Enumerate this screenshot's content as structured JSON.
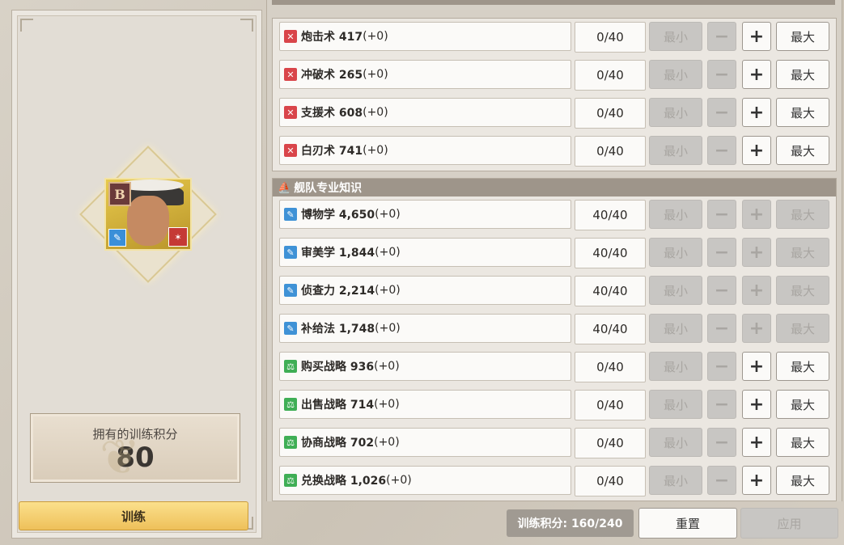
{
  "left": {
    "rank_letter": "B",
    "points_label": "拥有的训练积分",
    "points_value": "80",
    "train_label": "训练"
  },
  "skill_groups": [
    {
      "header": "",
      "rows": [
        {
          "icon": "crossed-swords-icon",
          "name": "炮击术 417",
          "bonus": "(+0)",
          "progress": "0/40",
          "min_label": "最小",
          "max_label": "最大",
          "plus_enabled": true,
          "max_enabled": true
        },
        {
          "icon": "crossed-swords-icon",
          "name": "冲破术 265",
          "bonus": "(+0)",
          "progress": "0/40",
          "min_label": "最小",
          "max_label": "最大",
          "plus_enabled": true,
          "max_enabled": true
        },
        {
          "icon": "crossed-swords-icon",
          "name": "支援术 608",
          "bonus": "(+0)",
          "progress": "0/40",
          "min_label": "最小",
          "max_label": "最大",
          "plus_enabled": true,
          "max_enabled": true
        },
        {
          "icon": "crossed-swords-icon",
          "name": "白刃术 741",
          "bonus": "(+0)",
          "progress": "0/40",
          "min_label": "最小",
          "max_label": "最大",
          "plus_enabled": true,
          "max_enabled": true
        }
      ]
    },
    {
      "header": "舰队专业知识",
      "rows": [
        {
          "icon": "brush-icon",
          "name": "博物学 4,650",
          "bonus": "(+0)",
          "progress": "40/40",
          "min_label": "最小",
          "max_label": "最大",
          "plus_enabled": false,
          "max_enabled": false
        },
        {
          "icon": "brush-icon",
          "name": "审美学 1,844",
          "bonus": "(+0)",
          "progress": "40/40",
          "min_label": "最小",
          "max_label": "最大",
          "plus_enabled": false,
          "max_enabled": false
        },
        {
          "icon": "brush-icon",
          "name": "侦查力 2,214",
          "bonus": "(+0)",
          "progress": "40/40",
          "min_label": "最小",
          "max_label": "最大",
          "plus_enabled": false,
          "max_enabled": false
        },
        {
          "icon": "brush-icon",
          "name": "补给法 1,748",
          "bonus": "(+0)",
          "progress": "40/40",
          "min_label": "最小",
          "max_label": "最大",
          "plus_enabled": false,
          "max_enabled": false
        },
        {
          "icon": "scales-icon",
          "name": "购买战略 936",
          "bonus": "(+0)",
          "progress": "0/40",
          "min_label": "最小",
          "max_label": "最大",
          "plus_enabled": true,
          "max_enabled": true
        },
        {
          "icon": "scales-icon",
          "name": "出售战略 714",
          "bonus": "(+0)",
          "progress": "0/40",
          "min_label": "最小",
          "max_label": "最大",
          "plus_enabled": true,
          "max_enabled": true
        },
        {
          "icon": "scales-icon",
          "name": "协商战略 702",
          "bonus": "(+0)",
          "progress": "0/40",
          "min_label": "最小",
          "max_label": "最大",
          "plus_enabled": true,
          "max_enabled": true
        },
        {
          "icon": "scales-icon",
          "name": "兑换战略 1,026",
          "bonus": "(+0)",
          "progress": "0/40",
          "min_label": "最小",
          "max_label": "最大",
          "plus_enabled": true,
          "max_enabled": true
        }
      ]
    }
  ],
  "footer": {
    "points_text": "训练积分: 160/240",
    "reset_label": "重置",
    "apply_label": "应用"
  },
  "colors": {
    "combat_icon": "#d9454a",
    "expertise_icon": "#3f92d6",
    "trade_icon": "#3fae55",
    "train_button": "#f4cf6e"
  }
}
